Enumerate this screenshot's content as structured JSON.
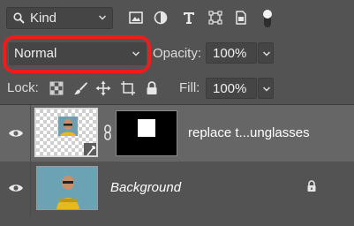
{
  "filter": {
    "kind_label": "Kind"
  },
  "blend": {
    "mode": "Normal",
    "opacity_label": "Opacity:",
    "opacity_value": "100%"
  },
  "lock": {
    "lock_label": "Lock:",
    "fill_label": "Fill:",
    "fill_value": "100%"
  },
  "layers": [
    {
      "name": "replace t...unglasses",
      "visible": true,
      "selected": true,
      "smart_object": true,
      "has_mask": true
    },
    {
      "name": "Background",
      "visible": true,
      "selected": false,
      "locked": true
    }
  ],
  "colors": {
    "panel_bg": "#535353",
    "selected_row": "#666666",
    "field_bg": "#454545",
    "highlight_ring": "#ee1c1c"
  }
}
